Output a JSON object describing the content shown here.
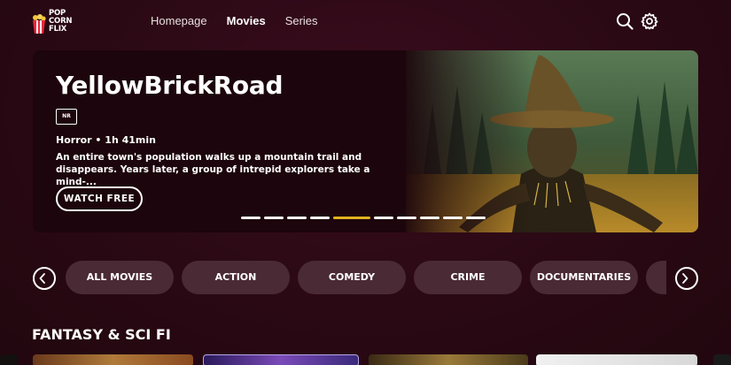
{
  "brand": {
    "logo_lines": [
      "POP",
      "CORN",
      "FLIX"
    ],
    "logo_name": "popcornflix-logo"
  },
  "nav": {
    "items": [
      {
        "label": "Homepage",
        "active": false
      },
      {
        "label": "Movies",
        "active": true
      },
      {
        "label": "Series",
        "active": false
      }
    ]
  },
  "header_icons": [
    "search-icon",
    "gear-icon"
  ],
  "hero": {
    "title": "YellowBrickRoad",
    "rating": "NR",
    "meta": "Horror • 1h 41min",
    "description": "An entire town's population walks up a mountain trail and disappears. Years later, a group of intrepid explorers take a mind-...",
    "button_label": "WATCH FREE",
    "slide_count": 10,
    "active_slide": 5
  },
  "categories": {
    "items": [
      "ALL MOVIES",
      "ACTION",
      "COMEDY",
      "CRIME",
      "DOCUMENTARIES",
      ""
    ],
    "prev_icon": "chevron-left-icon",
    "next_icon": "chevron-right-icon"
  },
  "section": {
    "title": "FANTASY & SCI FI"
  },
  "colors": {
    "background": "#2a0914",
    "accent": "#e3b21d",
    "pill": "#4a2a35"
  }
}
